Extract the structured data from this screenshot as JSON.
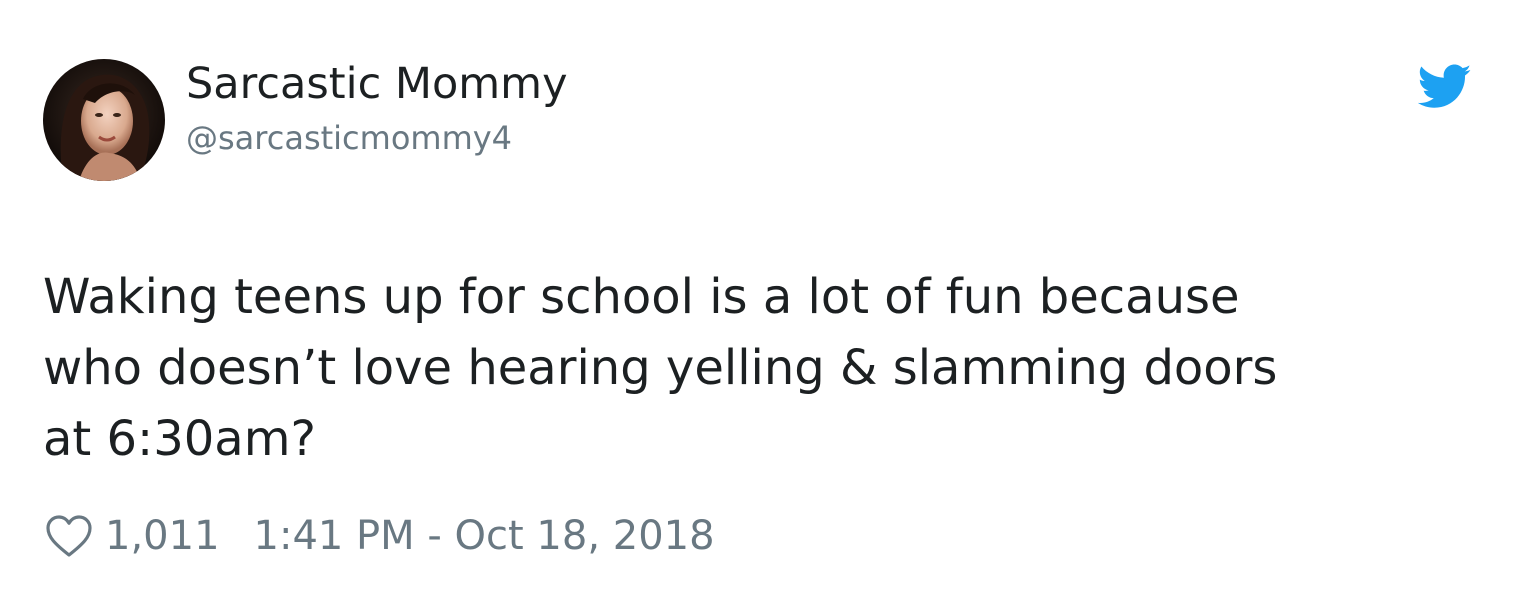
{
  "author": {
    "display_name": "Sarcastic Mommy",
    "handle": "@sarcasticmommy4",
    "avatar_icon": "user-avatar-photo"
  },
  "brand": {
    "icon": "twitter-bird-icon",
    "color": "#1da1f2"
  },
  "tweet": {
    "text": "Waking teens up for school is a lot of fun because\nwho doesn’t love hearing yelling & slamming doors\nat 6:30am?"
  },
  "footer": {
    "like_icon": "heart-icon",
    "like_count": "1,011",
    "timestamp": "1:41 PM - Oct 18, 2018"
  },
  "colors": {
    "text_primary": "#1c2022",
    "text_secondary": "#697882",
    "background": "#ffffff"
  }
}
